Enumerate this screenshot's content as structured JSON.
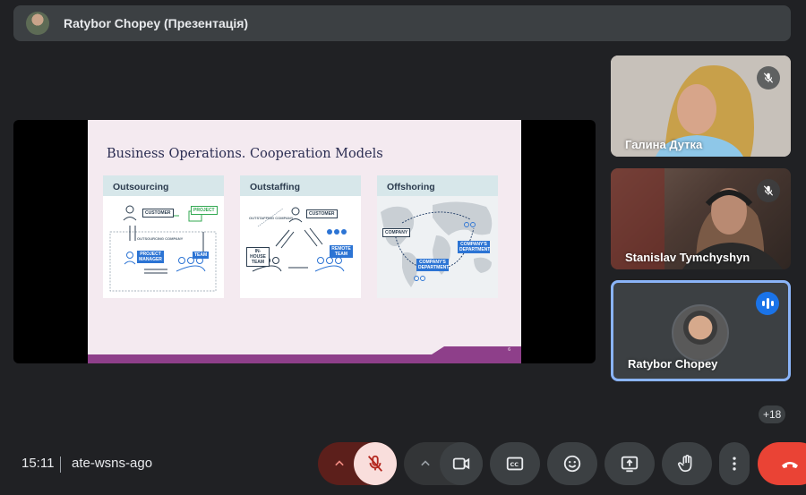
{
  "header": {
    "title": "Ratybor Chopey (Презентація)",
    "avatar_icon": "presenter-avatar"
  },
  "slide": {
    "title": "Business Operations. Cooperation Models",
    "panels": [
      {
        "heading": "Outsourcing",
        "labels": {
          "customer": "CUSTOMER",
          "project": "PROJECT",
          "outsourcing_company": "OUTSOURCING COMPANY",
          "pm": "PROJECT MANAGER",
          "team": "TEAM"
        }
      },
      {
        "heading": "Outstaffing",
        "labels": {
          "customer": "CUSTOMER",
          "outstaffing_company": "OUTSTAFFING COMPANY",
          "inhouse": "IN-HOUSE TEAM",
          "remote": "REMOTE TEAM"
        }
      },
      {
        "heading": "Offshoring",
        "labels": {
          "company": "COMPANY",
          "dept1": "COMPANY'S DEPARTMENT",
          "dept2": "COMPANY'S DEPARTMENT"
        }
      }
    ],
    "page_number": "6",
    "colors": {
      "accent": "#8e3f8a",
      "tag_blue": "#2c74d4",
      "bg": "#f4eaf0"
    }
  },
  "participants": [
    {
      "name": "Галина Дутка",
      "muted": true
    },
    {
      "name": "Stanislav Tymchyshyn",
      "muted": true
    },
    {
      "name": "Ratybor Chopey",
      "speaking": true
    }
  ],
  "more_participants": "+18",
  "footer": {
    "time": "15:11",
    "meeting_code": "ate-wsns-ago"
  },
  "controls": {
    "icons": [
      "chevron-up-icon",
      "mic-off-icon",
      "camera-icon",
      "captions-icon",
      "emoji-icon",
      "present-icon",
      "raise-hand-icon",
      "more-vert-icon",
      "end-call-icon"
    ],
    "colors": {
      "mic_off_bg": "#f9dedc",
      "end_call": "#ea4335",
      "speaking": "#1a73e8"
    }
  }
}
